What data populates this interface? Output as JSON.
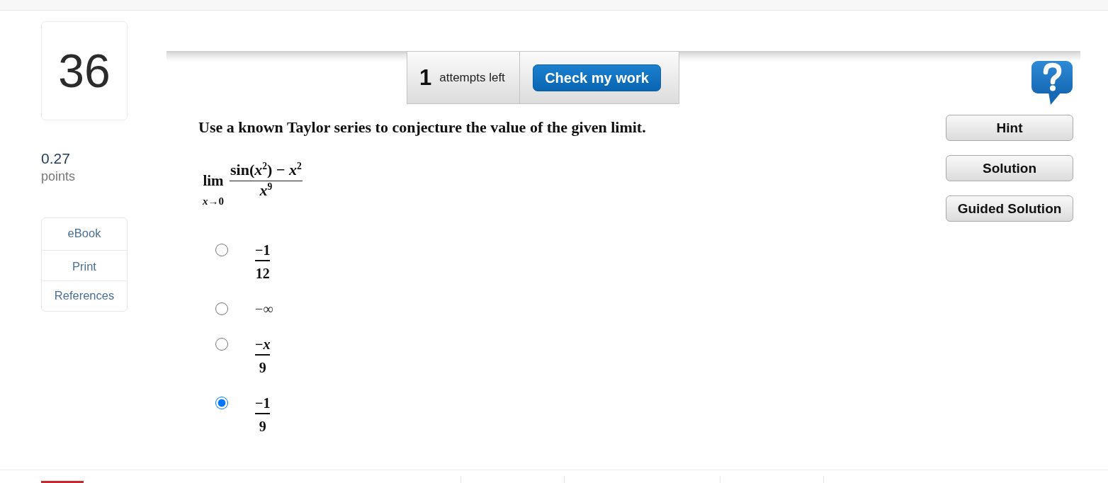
{
  "question": {
    "number": "36",
    "points": "0.27",
    "points_label": "points"
  },
  "resources": [
    {
      "label": "eBook"
    },
    {
      "label": "Print"
    },
    {
      "label": "References"
    }
  ],
  "attempts": {
    "count": "1",
    "label": "attempts left",
    "check_button": "Check my work"
  },
  "prompt": "Use a known Taylor series to conjecture the value of the given limit.",
  "limit": {
    "operator": "lim",
    "subscript": "*x*→0",
    "numerator": "sin(*x*$^{2}$) − *x*$^{2}$",
    "denominator": "*x*$^{9}$"
  },
  "choices": [
    {
      "kind": "fraction",
      "numerator": "−1",
      "denominator": "12",
      "selected": false
    },
    {
      "kind": "text",
      "text": "−∞",
      "selected": false
    },
    {
      "kind": "fraction",
      "numerator": "−*x*",
      "denominator": "9",
      "selected": false
    },
    {
      "kind": "fraction",
      "numerator": "−1",
      "denominator": "9",
      "selected": true
    }
  ],
  "side_buttons": [
    "Hint",
    "Solution",
    "Guided Solution"
  ]
}
